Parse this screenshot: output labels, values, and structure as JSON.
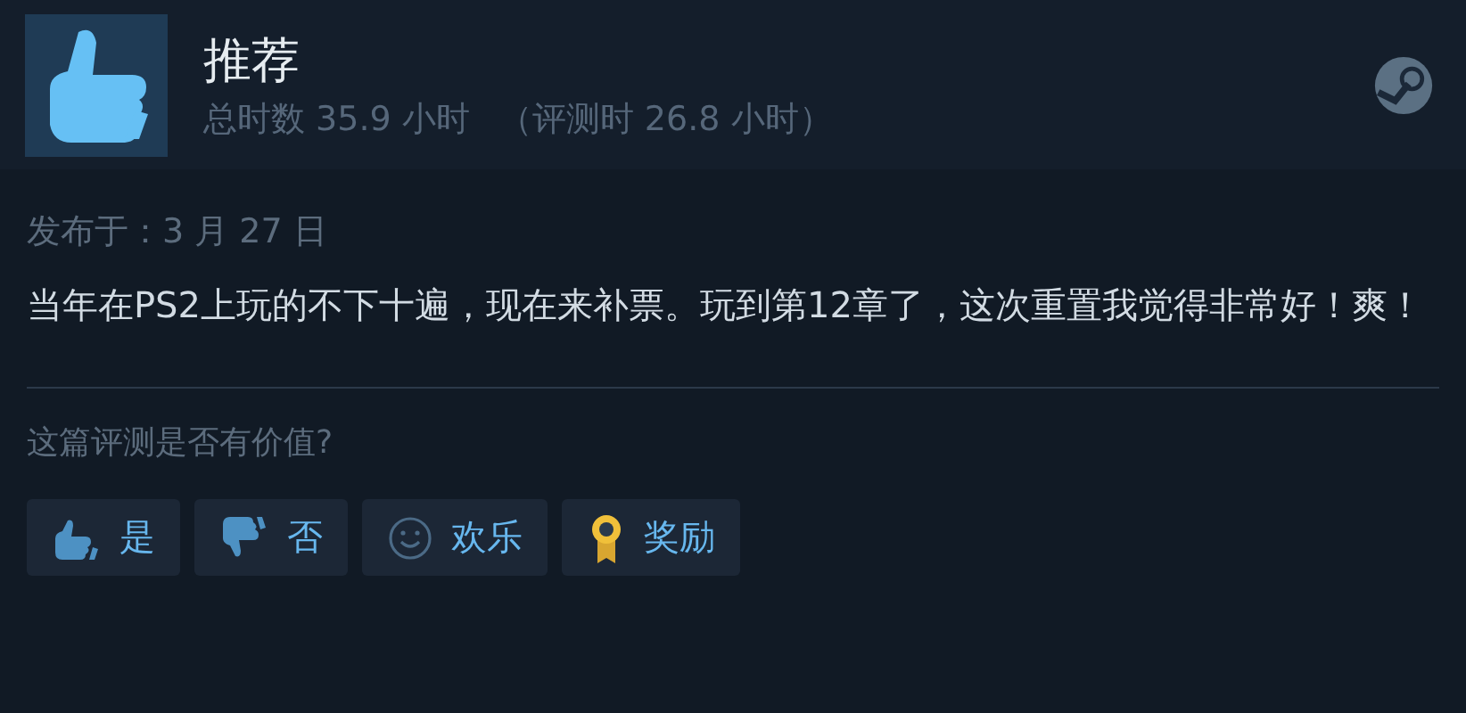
{
  "review": {
    "verdict": "推荐",
    "hours": "总时数 35.9 小时",
    "review_hours": "（评测时 26.8 小时）",
    "posted": "发布于：3 月 27 日",
    "text": "当年在PS2上玩的不下十遍，现在来补票。玩到第12章了，这次重置我觉得非常好！爽！"
  },
  "helpful": {
    "question": "这篇评测是否有价值?",
    "buttons": [
      {
        "kind": "yes",
        "label": "是"
      },
      {
        "kind": "no",
        "label": "否"
      },
      {
        "kind": "funny",
        "label": "欢乐"
      },
      {
        "kind": "award",
        "label": "奖励"
      }
    ]
  }
}
